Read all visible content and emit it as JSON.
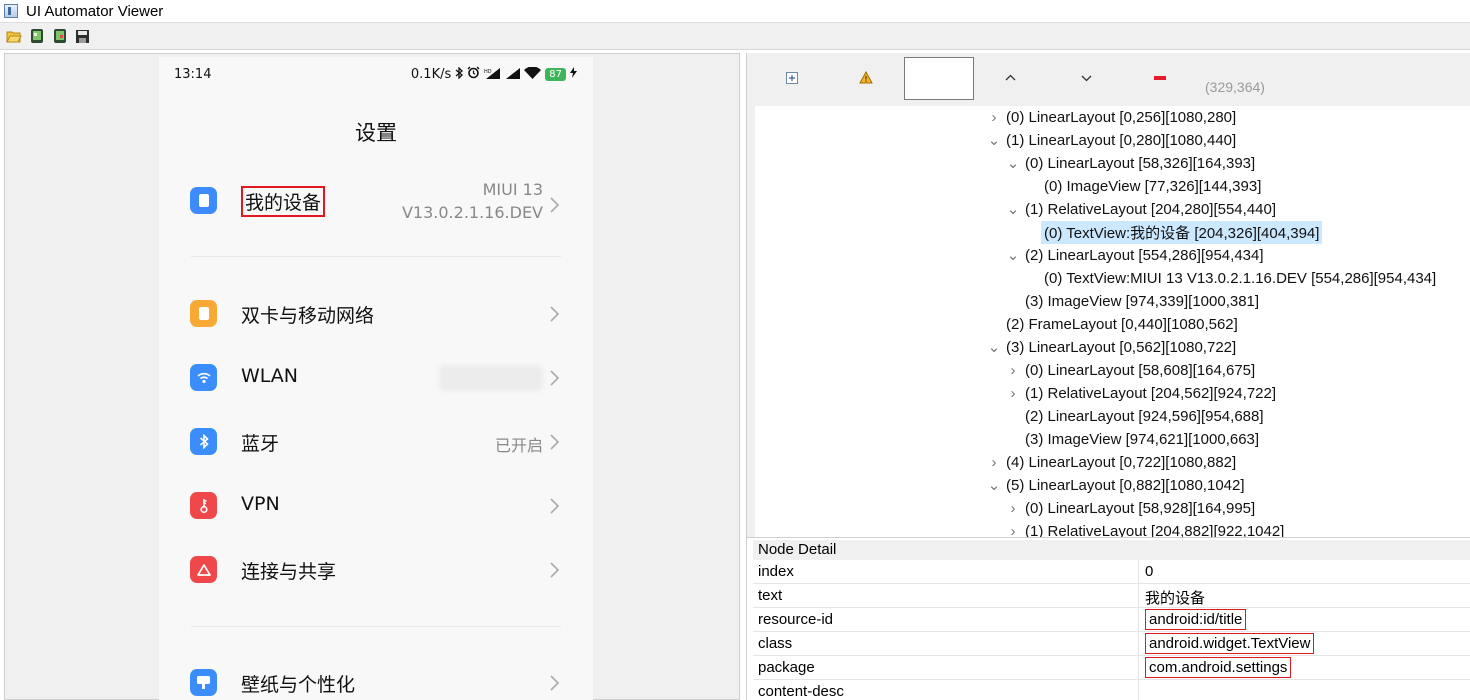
{
  "window": {
    "title": "UI Automator Viewer"
  },
  "toolbar": {
    "buttons": [
      "open-icon",
      "device-screenshot-icon",
      "device-screenshot-compressed-icon",
      "save-icon"
    ]
  },
  "phone": {
    "status": {
      "time": "13:14",
      "speed": "0.1K/s",
      "battery": "87"
    },
    "page_title": "设置",
    "rows": [
      {
        "label": "我的设备",
        "value_line1": "MIUI 13",
        "value_line2": "V13.0.2.1.16.DEV",
        "icon": "phone-icon",
        "icon_color": "#3d8bfd"
      },
      {
        "label": "双卡与移动网络",
        "value": "",
        "icon": "sim-icon",
        "icon_color": "#f8a934"
      },
      {
        "label": "WLAN",
        "value": "",
        "icon": "wifi-icon",
        "icon_color": "#3b8dfb"
      },
      {
        "label": "蓝牙",
        "value": "已开启",
        "icon": "bluetooth-icon",
        "icon_color": "#3b8dfb"
      },
      {
        "label": "VPN",
        "value": "",
        "icon": "vpn-key-icon",
        "icon_color": "#f0484a"
      },
      {
        "label": "连接与共享",
        "value": "",
        "icon": "share-icon",
        "icon_color": "#f0484a"
      },
      {
        "label": "壁纸与个性化",
        "value": "",
        "icon": "wallpaper-icon",
        "icon_color": "#3b8dfb"
      }
    ]
  },
  "tree_toolbar": {
    "coords": "(329,364)",
    "icons": [
      "expand-all-icon",
      "warning-icon",
      "search-field",
      "chevron-up-icon",
      "chevron-down-icon",
      "minus-icon"
    ]
  },
  "tree": [
    {
      "toggle": ">",
      "text": "(0) LinearLayout [0,256][1080,280]",
      "level": 0
    },
    {
      "toggle": "v",
      "text": "(1) LinearLayout [0,280][1080,440]",
      "level": 0
    },
    {
      "toggle": "v",
      "text": "(0) LinearLayout [58,326][164,393]",
      "level": 1
    },
    {
      "toggle": "",
      "text": "(0) ImageView [77,326][144,393]",
      "level": 2
    },
    {
      "toggle": "v",
      "text": "(1) RelativeLayout [204,280][554,440]",
      "level": 1
    },
    {
      "toggle": "",
      "text": "(0) TextView:我的设备 [204,326][404,394]",
      "level": 2,
      "selected": true
    },
    {
      "toggle": "v",
      "text": "(2) LinearLayout [554,286][954,434]",
      "level": 1
    },
    {
      "toggle": "",
      "text": "(0) TextView:MIUI 13 V13.0.2.1.16.DEV [554,286][954,434]",
      "level": 2
    },
    {
      "toggle": "",
      "text": "(3) ImageView [974,339][1000,381]",
      "level": 1
    },
    {
      "toggle": "",
      "text": "(2) FrameLayout [0,440][1080,562]",
      "level": 0
    },
    {
      "toggle": "v",
      "text": "(3) LinearLayout [0,562][1080,722]",
      "level": 0
    },
    {
      "toggle": ">",
      "text": "(0) LinearLayout [58,608][164,675]",
      "level": 1
    },
    {
      "toggle": ">",
      "text": "(1) RelativeLayout [204,562][924,722]",
      "level": 1
    },
    {
      "toggle": "",
      "text": "(2) LinearLayout [924,596][954,688]",
      "level": 1
    },
    {
      "toggle": "",
      "text": "(3) ImageView [974,621][1000,663]",
      "level": 1
    },
    {
      "toggle": ">",
      "text": "(4) LinearLayout [0,722][1080,882]",
      "level": 0
    },
    {
      "toggle": "v",
      "text": "(5) LinearLayout [0,882][1080,1042]",
      "level": 0
    },
    {
      "toggle": ">",
      "text": "(0) LinearLayout [58,928][164,995]",
      "level": 1
    },
    {
      "toggle": ">",
      "text": "(1) RelativeLayout [204,882][922,1042]",
      "level": 1
    }
  ],
  "node_detail": {
    "title": "Node Detail",
    "rows": [
      {
        "key": "index",
        "value": "0"
      },
      {
        "key": "text",
        "value": "我的设备"
      },
      {
        "key": "resource-id",
        "value": "android:id/title",
        "boxed": true
      },
      {
        "key": "class",
        "value": "android.widget.TextView",
        "boxed": true
      },
      {
        "key": "package",
        "value": "com.android.settings",
        "boxed": true
      },
      {
        "key": "content-desc",
        "value": ""
      }
    ]
  }
}
